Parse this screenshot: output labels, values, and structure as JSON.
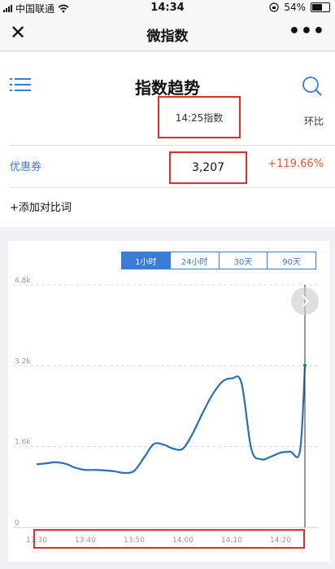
{
  "status_bar": {
    "carrier": "中国联通",
    "time": "14:34",
    "battery": "54%"
  },
  "nav": {
    "title": "微指数"
  },
  "header": {
    "page_title": "指数趋势",
    "index_label": "14:25指数",
    "ratio_label": "环比"
  },
  "row": {
    "keyword": "优惠券",
    "value": "3,207",
    "change": "+119.66%"
  },
  "add_compare": "+添加对比词",
  "range_tabs": [
    "1小时",
    "24小时",
    "30天",
    "90天"
  ],
  "colors": {
    "accent": "#3a7bd5",
    "up": "#e25a2b",
    "highlight_box": "#d9302e"
  },
  "chart_data": {
    "type": "line",
    "yticks": [
      "4.8k",
      "3.2k",
      "1.6k",
      "0"
    ],
    "ylim": [
      0,
      4800
    ],
    "xticks": [
      "13:30",
      "13:40",
      "13:50",
      "14:00",
      "14:10",
      "14:20"
    ],
    "x": [
      "13:30",
      "13:32",
      "13:34",
      "13:36",
      "13:38",
      "13:40",
      "13:42",
      "13:44",
      "13:46",
      "13:48",
      "13:50",
      "13:52",
      "13:54",
      "13:56",
      "13:58",
      "14:00",
      "14:02",
      "14:04",
      "14:06",
      "14:08",
      "14:10",
      "14:12",
      "14:14",
      "14:16",
      "14:18",
      "14:20",
      "14:22",
      "14:24",
      "14:25"
    ],
    "values": [
      1250,
      1270,
      1290,
      1260,
      1180,
      1140,
      1140,
      1130,
      1110,
      1080,
      1120,
      1380,
      1650,
      1640,
      1560,
      1560,
      1860,
      2260,
      2620,
      2880,
      2950,
      2860,
      1560,
      1350,
      1400,
      1480,
      1500,
      1520,
      3207
    ]
  }
}
